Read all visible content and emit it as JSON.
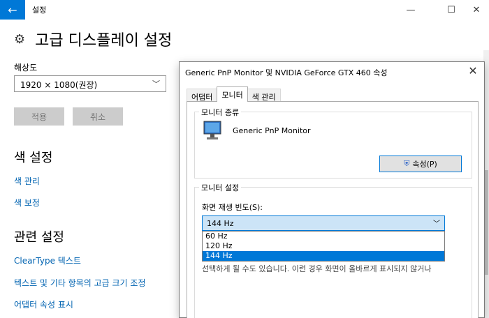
{
  "window": {
    "app_title": "설정",
    "minimize_glyph": "—",
    "maximize_glyph": "☐",
    "close_glyph": "✕",
    "back_glyph": "←"
  },
  "page": {
    "title": "고급 디스플레이 설정",
    "resolution_label": "해상도",
    "resolution_value": "1920 × 1080(권장)",
    "apply_label": "적용",
    "cancel_label": "취소",
    "color_section": "색 설정",
    "color_links": [
      "색 관리",
      "색 보정"
    ],
    "related_section": "관련 설정",
    "related_links": [
      "ClearType 텍스트",
      "텍스트 및 기타 항목의 고급 크기 조정",
      "어댑터 속성 표시"
    ]
  },
  "dialog": {
    "title": "Generic PnP Monitor 및 NVIDIA GeForce GTX 460 속성",
    "tabs": [
      "어댑터",
      "모니터",
      "색 관리"
    ],
    "active_tab": 1,
    "monitor_type_label": "모니터 종류",
    "monitor_name": "Generic PnP Monitor",
    "properties_button": "속성(P)",
    "monitor_settings_label": "모니터 설정",
    "refresh_label": "화면 재생 빈도(S):",
    "refresh_value": "144 Hz",
    "refresh_options": [
      "60 Hz",
      "120 Hz",
      "144 Hz"
    ],
    "refresh_selected": 2,
    "note_line1": "선택하게 될 수도 있습니다. 이런 경우 화면이 올바르게 표시되지 않거나"
  },
  "colors": {
    "accent": "#0078d7",
    "link": "#0063b1"
  }
}
